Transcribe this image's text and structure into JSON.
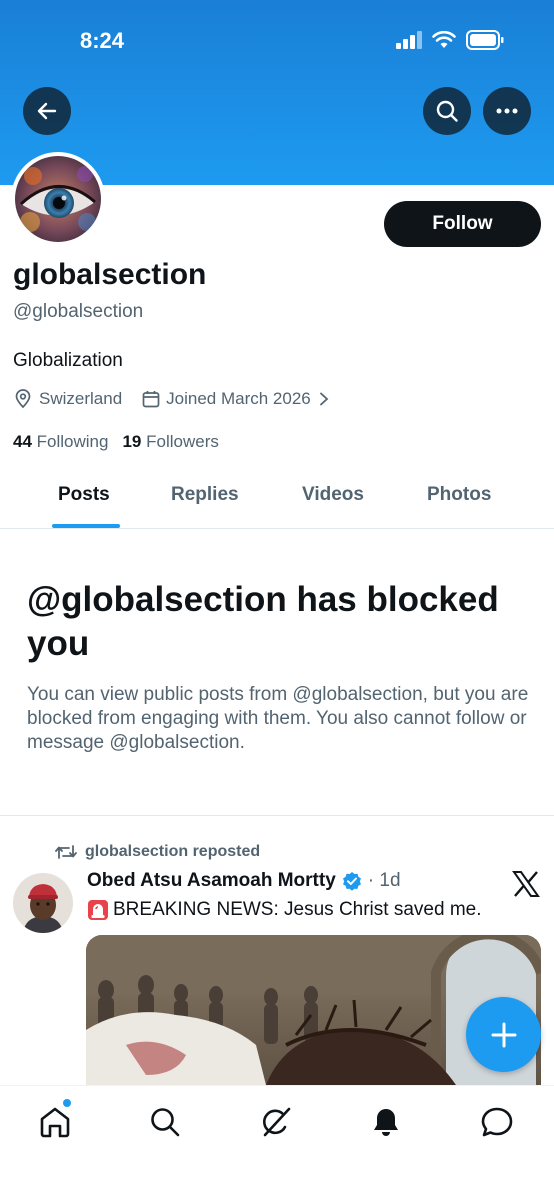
{
  "status_bar": {
    "time": "8:24"
  },
  "profile": {
    "display_name": "globalsection",
    "handle": "@globalsection",
    "bio": "Globalization",
    "location": "Swizerland",
    "joined": "Joined March 2026",
    "following_count": "44",
    "following_label": "Following",
    "followers_count": "19",
    "followers_label": "Followers",
    "follow_button": "Follow"
  },
  "tabs": [
    {
      "label": "Posts",
      "active": true
    },
    {
      "label": "Replies",
      "active": false
    },
    {
      "label": "Videos",
      "active": false
    },
    {
      "label": "Photos",
      "active": false
    }
  ],
  "blocked": {
    "title": "@globalsection has blocked you",
    "body": "You can view public posts from @globalsection, but you are blocked from engaging with them. You also cannot follow or message @globalsection."
  },
  "post": {
    "repost_label": "globalsection reposted",
    "author_name": "Obed Atsu Asamoah Mortty",
    "time": "· 1d",
    "text": "BREAKING NEWS: Jesus Christ saved me."
  },
  "colors": {
    "accent": "#1d9bf0",
    "text": "#0f1419",
    "muted": "#536471"
  }
}
